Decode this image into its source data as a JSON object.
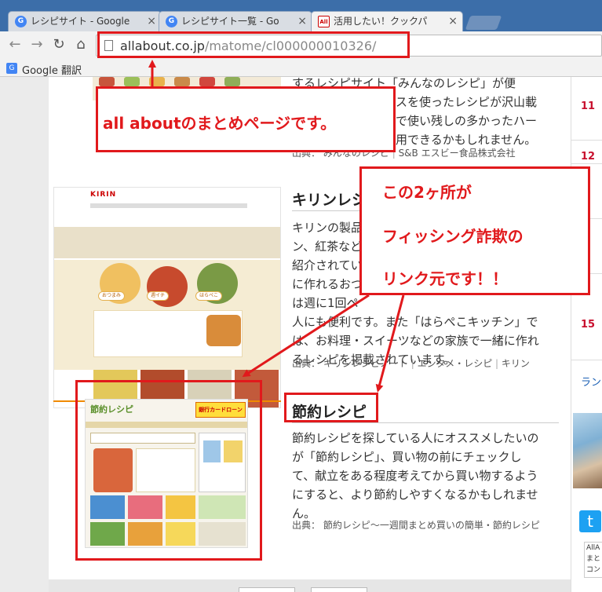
{
  "browser": {
    "tabs": [
      {
        "title": "レシピサイト - Google",
        "icon": "google-favicon"
      },
      {
        "title": "レシピサイト一覧 - Go",
        "icon": "google-favicon"
      },
      {
        "title": "活用したい！クックパ",
        "icon": "allabout-favicon"
      }
    ],
    "tab_close_glyph": "×",
    "url_domain": "allabout.co.jp",
    "url_path": "/matome/cl000000010326/",
    "bookmark_label": "Google 翻訳"
  },
  "article": {
    "item1": {
      "text_line1": "するレシピサイト「みんなのレシピ」が便",
      "text_line2": "スを使ったレシピが沢山載",
      "text_line3": "で使い残しの多かったハー",
      "text_line4": "用できるかもしれません。",
      "source_label": "出典：",
      "source_1": "みんなのレシピ",
      "source_2": "S&B エスビー食品株式会社"
    },
    "item2": {
      "heading": "キリンレシ",
      "text_lines": [
        "キリンの製品",
        "ン、紅茶など",
        "紹介されてい",
        "に作れるおつ",
        "は週に1回ペ",
        "人にも便利です。また「はらぺこキッチン」で",
        "は、お料理・スイーツなどの家族で一緒に作れ",
        "るレシピを掲載されています。"
      ],
      "source_label": "出典：",
      "source_1": "キリンレシピノート",
      "source_2": "エンタメ・レシピ",
      "source_3": "キリン",
      "thumb_logo": "KIRIN"
    },
    "item3": {
      "heading": "節約レシピ",
      "text_lines": [
        "節約レシピを探している人にオススメしたいの",
        "が「節約レシピ」、買い物の前にチェックし",
        "て、献立をある程度考えてから買い物するよう",
        "にすると、より節約しやすくなるかもしれませ",
        "ん。"
      ],
      "source_label": "出典：",
      "source_1": "節約レシピ～一週間まとめ買いの簡単・節約レシピ",
      "thumb_logo": "節約レシピ",
      "thumb_banner": "銀行カードローン"
    }
  },
  "sidebar": {
    "ranks": [
      "11",
      "12",
      "15"
    ],
    "link_text": "ラン",
    "ad_text": "AllAまとコン"
  },
  "annotations": {
    "box1": "all aboutのまとめページです。",
    "box2_line1": "この2ヶ所が",
    "box2_line2": "フィッシング詐欺の",
    "box2_line3": "リンク元です！！",
    "color": "#e1191c"
  }
}
